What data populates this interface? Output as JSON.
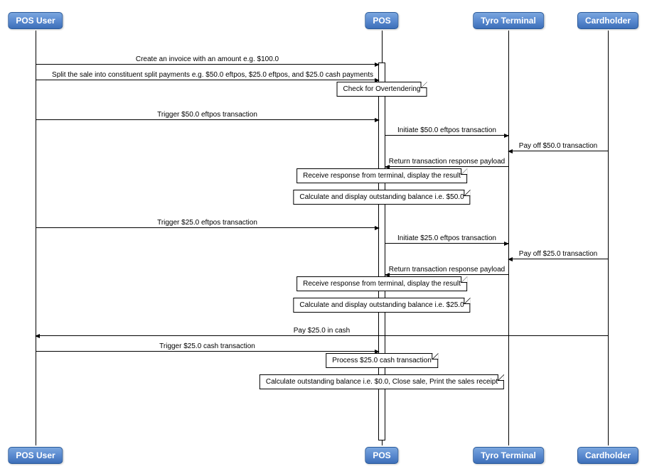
{
  "participants": {
    "pos_user": "POS User",
    "pos": "POS",
    "tyro_terminal": "Tyro Terminal",
    "cardholder": "Cardholder"
  },
  "messages": {
    "m1": "Create an invoice with an amount e.g. $100.0",
    "m2": "Split the sale into constituent split payments e.g. $50.0 eftpos, $25.0 eftpos, and $25.0 cash payments",
    "m3": "Trigger $50.0 eftpos transaction",
    "m4": "Initiate $50.0 eftpos transaction",
    "m5": "Pay off $50.0 transaction",
    "m6": "Return transaction response payload",
    "m7": "Trigger $25.0 eftpos transaction",
    "m8": "Initiate $25.0 eftpos transaction",
    "m9": "Pay off $25.0 transaction",
    "m10": "Return transaction response payload",
    "m11": "Pay $25.0 in cash",
    "m12": "Trigger $25.0 cash transaction"
  },
  "notes": {
    "n1": "Check for Overtendering",
    "n2": "Receive response from terminal, display the result",
    "n3": "Calculate and display outstanding balance i.e. $50.0",
    "n4": "Receive response from terminal, display the result",
    "n5": "Calculate and display outstanding balance i.e. $25.0",
    "n6": "Process $25.0 cash transaction",
    "n7": "Calculate outstanding balance i.e. $0.0, Close sale, Print the sales receipt"
  },
  "chart_data": {
    "type": "sequence_diagram",
    "participants": [
      "POS User",
      "POS",
      "Tyro Terminal",
      "Cardholder"
    ],
    "interactions": [
      {
        "from": "POS User",
        "to": "POS",
        "label": "Create an invoice with an amount e.g. $100.0"
      },
      {
        "from": "POS User",
        "to": "POS",
        "label": "Split the sale into constituent split payments e.g. $50.0 eftpos, $25.0 eftpos, and $25.0 cash payments"
      },
      {
        "note_over": "POS",
        "label": "Check for Overtendering"
      },
      {
        "from": "POS User",
        "to": "POS",
        "label": "Trigger $50.0 eftpos transaction"
      },
      {
        "from": "POS",
        "to": "Tyro Terminal",
        "label": "Initiate $50.0 eftpos transaction"
      },
      {
        "from": "Cardholder",
        "to": "Tyro Terminal",
        "label": "Pay off $50.0 transaction"
      },
      {
        "from": "Tyro Terminal",
        "to": "POS",
        "label": "Return transaction response payload"
      },
      {
        "note_over": "POS",
        "label": "Receive response from terminal, display the result"
      },
      {
        "note_over": "POS",
        "label": "Calculate and display outstanding balance i.e. $50.0"
      },
      {
        "from": "POS User",
        "to": "POS",
        "label": "Trigger $25.0 eftpos transaction"
      },
      {
        "from": "POS",
        "to": "Tyro Terminal",
        "label": "Initiate $25.0 eftpos transaction"
      },
      {
        "from": "Cardholder",
        "to": "Tyro Terminal",
        "label": "Pay off $25.0 transaction"
      },
      {
        "from": "Tyro Terminal",
        "to": "POS",
        "label": "Return transaction response payload"
      },
      {
        "note_over": "POS",
        "label": "Receive response from terminal, display the result"
      },
      {
        "note_over": "POS",
        "label": "Calculate and display outstanding balance i.e. $25.0"
      },
      {
        "from": "Cardholder",
        "to": "POS User",
        "label": "Pay $25.0 in cash"
      },
      {
        "from": "POS User",
        "to": "POS",
        "label": "Trigger $25.0 cash transaction"
      },
      {
        "note_over": "POS",
        "label": "Process $25.0 cash transaction"
      },
      {
        "note_over": "POS",
        "label": "Calculate outstanding balance i.e. $0.0, Close sale, Print the sales receipt"
      }
    ]
  }
}
